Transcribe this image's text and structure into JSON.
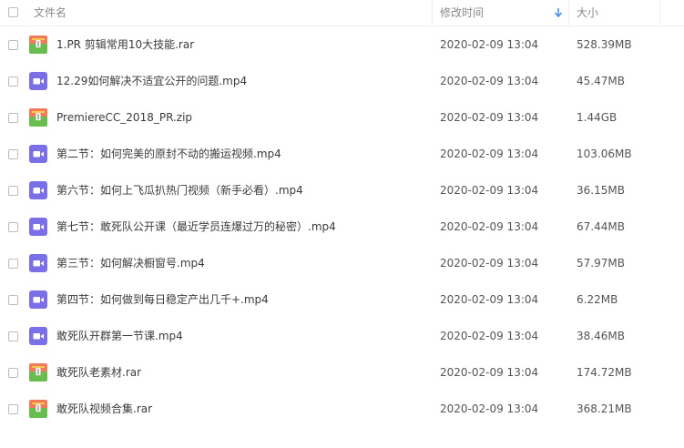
{
  "header": {
    "name_label": "文件名",
    "time_label": "修改时间",
    "size_label": "大小",
    "sort_icon": "sort-down-arrow-icon"
  },
  "colors": {
    "video_icon": "#7b6fe8",
    "archive_icon_top": "#f07a5a",
    "archive_icon_bottom": "#69bd4e",
    "sort_arrow": "#4a90e2"
  },
  "files": [
    {
      "name": "1.PR 剪辑常用10大技能.rar",
      "time": "2020-02-09 13:04",
      "size": "528.39MB",
      "icon": "archive-icon"
    },
    {
      "name": "12.29如何解决不适宜公开的问题.mp4",
      "time": "2020-02-09 13:04",
      "size": "45.47MB",
      "icon": "video-icon"
    },
    {
      "name": "PremiereCC_2018_PR.zip",
      "time": "2020-02-09 13:04",
      "size": "1.44GB",
      "icon": "archive-icon"
    },
    {
      "name": "第二节：如何完美的原封不动的搬运视频.mp4",
      "time": "2020-02-09 13:04",
      "size": "103.06MB",
      "icon": "video-icon"
    },
    {
      "name": "第六节：如何上飞瓜扒热门视频（新手必看）.mp4",
      "time": "2020-02-09 13:04",
      "size": "36.15MB",
      "icon": "video-icon"
    },
    {
      "name": "第七节：敢死队公开课（最近学员连爆过万的秘密）.mp4",
      "time": "2020-02-09 13:04",
      "size": "67.44MB",
      "icon": "video-icon"
    },
    {
      "name": "第三节：如何解决橱窗号.mp4",
      "time": "2020-02-09 13:04",
      "size": "57.97MB",
      "icon": "video-icon"
    },
    {
      "name": "第四节：如何做到每日稳定产出几千+.mp4",
      "time": "2020-02-09 13:04",
      "size": "6.22MB",
      "icon": "video-icon"
    },
    {
      "name": "敢死队开群第一节课.mp4",
      "time": "2020-02-09 13:04",
      "size": "38.46MB",
      "icon": "video-icon"
    },
    {
      "name": "敢死队老素材.rar",
      "time": "2020-02-09 13:04",
      "size": "174.72MB",
      "icon": "archive-icon"
    },
    {
      "name": "敢死队视频合集.rar",
      "time": "2020-02-09 13:04",
      "size": "368.21MB",
      "icon": "archive-icon"
    }
  ]
}
